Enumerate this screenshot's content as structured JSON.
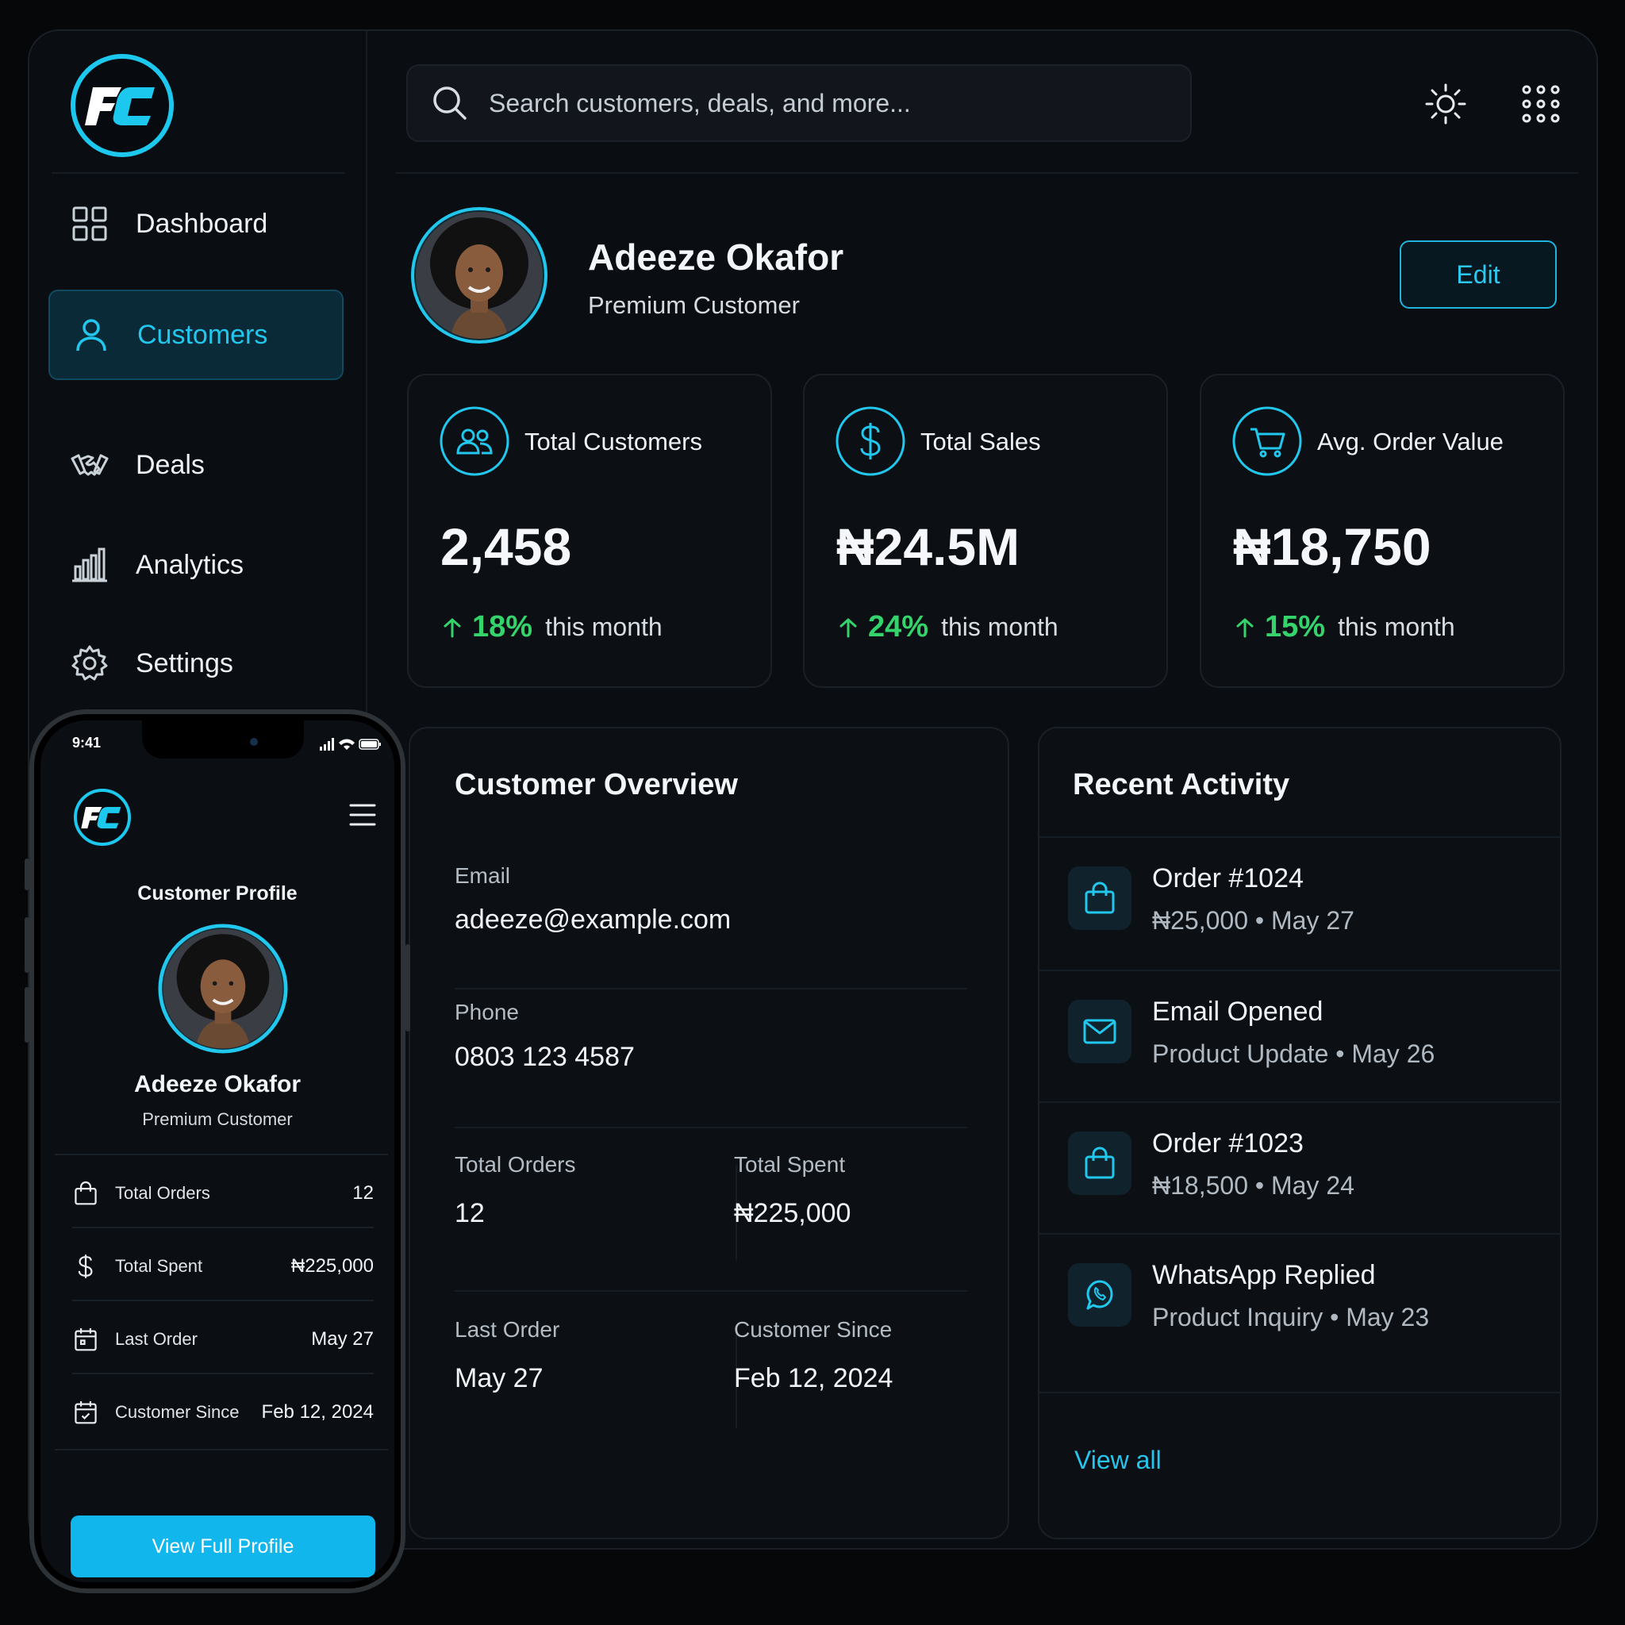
{
  "brand": {
    "logo_text": "FC",
    "accent": "#22c7ee",
    "positive": "#34d36b",
    "bg": "#0a0d11"
  },
  "sidebar": {
    "items": [
      {
        "label": "Dashboard",
        "icon": "grid-icon",
        "active": false
      },
      {
        "label": "Customers",
        "icon": "user-icon",
        "active": true
      },
      {
        "label": "Deals",
        "icon": "handshake-icon",
        "active": false
      },
      {
        "label": "Analytics",
        "icon": "bar-chart-icon",
        "active": false
      },
      {
        "label": "Settings",
        "icon": "gear-icon",
        "active": false
      }
    ]
  },
  "header": {
    "search_placeholder": "Search customers, deals, and more...",
    "theme_icon": "sun-icon",
    "apps_icon": "apps-grid-icon"
  },
  "profile": {
    "name": "Adeeze Okafor",
    "tier": "Premium Customer",
    "edit_label": "Edit"
  },
  "stats": [
    {
      "label": "Total Customers",
      "value": "2,458",
      "change": "18%",
      "period": "this month",
      "icon": "users-icon"
    },
    {
      "label": "Total Sales",
      "value": "₦24.5M",
      "change": "24%",
      "period": "this month",
      "icon": "dollar-icon"
    },
    {
      "label": "Avg. Order Value",
      "value": "₦18,750",
      "change": "15%",
      "period": "this month",
      "icon": "cart-icon"
    }
  ],
  "overview": {
    "title": "Customer Overview",
    "email_label": "Email",
    "email": "adeeze@example.com",
    "phone_label": "Phone",
    "phone": "0803 123 4587",
    "total_orders_label": "Total Orders",
    "total_orders": "12",
    "total_spent_label": "Total Spent",
    "total_spent": "₦225,000",
    "last_order_label": "Last Order",
    "last_order": "May 27",
    "customer_since_label": "Customer Since",
    "customer_since": "Feb 12, 2024"
  },
  "activity": {
    "title": "Recent Activity",
    "items": [
      {
        "title": "Order #1024",
        "detail": "₦25,000",
        "date": "May 27",
        "icon": "shopping-bag-icon"
      },
      {
        "title": "Email Opened",
        "detail": "Product Update",
        "date": "May 26",
        "icon": "mail-icon"
      },
      {
        "title": "Order #1023",
        "detail": "₦18,500",
        "date": "May 24",
        "icon": "shopping-bag-icon"
      },
      {
        "title": "WhatsApp Replied",
        "detail": "Product Inquiry",
        "date": "May 23",
        "icon": "whatsapp-icon"
      }
    ],
    "separator": "•",
    "view_all": "View all"
  },
  "phone": {
    "time": "9:41",
    "title": "Customer Profile",
    "name": "Adeeze Okafor",
    "tier": "Premium Customer",
    "rows": [
      {
        "label": "Total Orders",
        "value": "12",
        "icon": "shopping-bag-icon"
      },
      {
        "label": "Total Spent",
        "value": "₦225,000",
        "icon": "dollar-icon"
      },
      {
        "label": "Last Order",
        "value": "May 27",
        "icon": "calendar-icon"
      },
      {
        "label": "Customer Since",
        "value": "Feb 12, 2024",
        "icon": "calendar-icon"
      }
    ],
    "button": "View Full Profile"
  }
}
